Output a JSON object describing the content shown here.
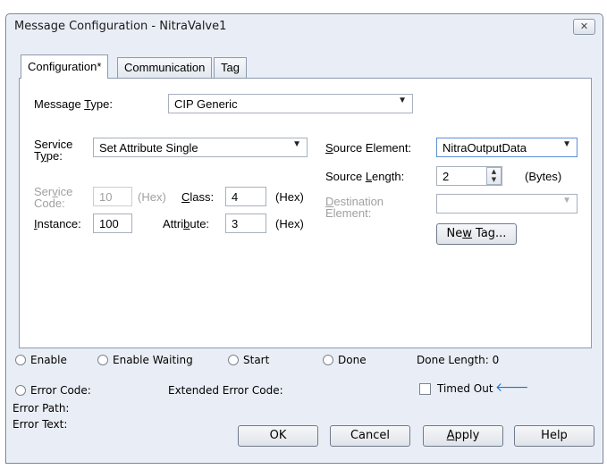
{
  "window": {
    "title": "Message Configuration - NitraValve1",
    "close_glyph": "✕"
  },
  "tabs": [
    {
      "label": "Configuration*",
      "active": true
    },
    {
      "label": "Communication",
      "active": false
    },
    {
      "label": "Tag",
      "active": false
    }
  ],
  "config": {
    "message_type": {
      "label_pre": "Message ",
      "label_u": "T",
      "label_post": "ype:",
      "value": "CIP Generic"
    },
    "service_type": {
      "label_l1": "Service",
      "label_l2_u": "y",
      "label_l2_pre": "T",
      "label_l2_post": "pe:",
      "value": "Set Attribute Single"
    },
    "service_code": {
      "label_l1_pre": "Ser",
      "label_l1_u": "v",
      "label_l1_post": "ice",
      "label_l2": "Code:",
      "value": "10",
      "unit": "(Hex)"
    },
    "class": {
      "label_u": "C",
      "label_post": "lass:",
      "value": "4",
      "unit": "(Hex)"
    },
    "instance": {
      "label_u": "I",
      "label_post": "nstance:",
      "value": "100"
    },
    "attribute": {
      "label_pre": "Attri",
      "label_u": "b",
      "label_post": "ute:",
      "value": "3",
      "unit": "(Hex)"
    },
    "source_element": {
      "label_u": "S",
      "label_post": "ource Element:",
      "value": "NitraOutputData"
    },
    "source_length": {
      "label_pre": "Source ",
      "label_u": "L",
      "label_post": "ength:",
      "value": "2",
      "unit": "(Bytes)"
    },
    "destination_element": {
      "label_u": "D",
      "label_l1_post": "estination",
      "label_l2": "Element:",
      "value": ""
    },
    "new_tag_button": {
      "pre": "Ne",
      "u": "w",
      "post": " Tag..."
    }
  },
  "status": {
    "enable": "Enable",
    "enable_waiting": "Enable Waiting",
    "start": "Start",
    "done": "Done",
    "done_length": "Done Length: 0",
    "error_code": "Error Code:",
    "extended_error_code": "Extended Error Code:",
    "timed_out": "Timed Out",
    "timed_out_arrow": "🡐",
    "error_path": "Error Path:",
    "error_text": "Error Text:"
  },
  "buttons": {
    "ok": "OK",
    "cancel": "Cancel",
    "apply_u": "A",
    "apply_post": "pply",
    "help": "Help"
  },
  "colors": {
    "accent_arrow": "#1f6fd0",
    "disabled_text": "#a0a0a0"
  },
  "icons": {
    "close": "close-icon",
    "dropdown": "chevron-down-icon",
    "spin": "spin-up-down-icon",
    "arrow": "arrow-left-icon"
  }
}
